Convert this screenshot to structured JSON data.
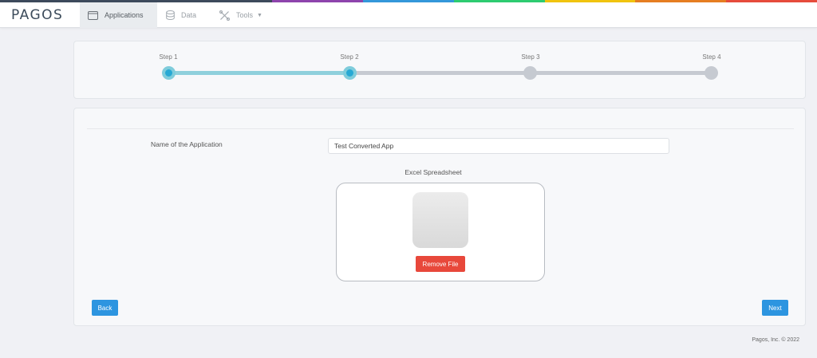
{
  "brand": {
    "logo_text": "PAGOS",
    "rainbow_colors": [
      "#3d4a5c",
      "#8e44ad",
      "#3498db",
      "#2ecc71",
      "#f1c40f",
      "#e67e22",
      "#e74c3c"
    ]
  },
  "nav": {
    "items": [
      {
        "label": "Applications",
        "icon": "window-icon",
        "active": true
      },
      {
        "label": "Data",
        "icon": "database-icon",
        "active": false
      },
      {
        "label": "Tools",
        "icon": "tools-icon",
        "active": false,
        "has_dropdown": true
      }
    ]
  },
  "stepper": {
    "steps": [
      {
        "label": "Step 1",
        "state": "complete"
      },
      {
        "label": "Step 2",
        "state": "current"
      },
      {
        "label": "Step 3",
        "state": "pending"
      },
      {
        "label": "Step 4",
        "state": "pending"
      }
    ],
    "colors": {
      "active": "#27a9d4",
      "track_done": "#8fd0dc",
      "track_pending": "#c6cad1"
    }
  },
  "form": {
    "name_label": "Name of the Application",
    "name_value": "Test Converted App",
    "spreadsheet_label": "Excel Spreadsheet",
    "remove_label": "Remove File",
    "back_label": "Back",
    "next_label": "Next"
  },
  "footer": {
    "copyright": "Pagos, Inc. © 2022"
  },
  "colors": {
    "primary": "#2d95e0",
    "danger": "#e8483b"
  }
}
